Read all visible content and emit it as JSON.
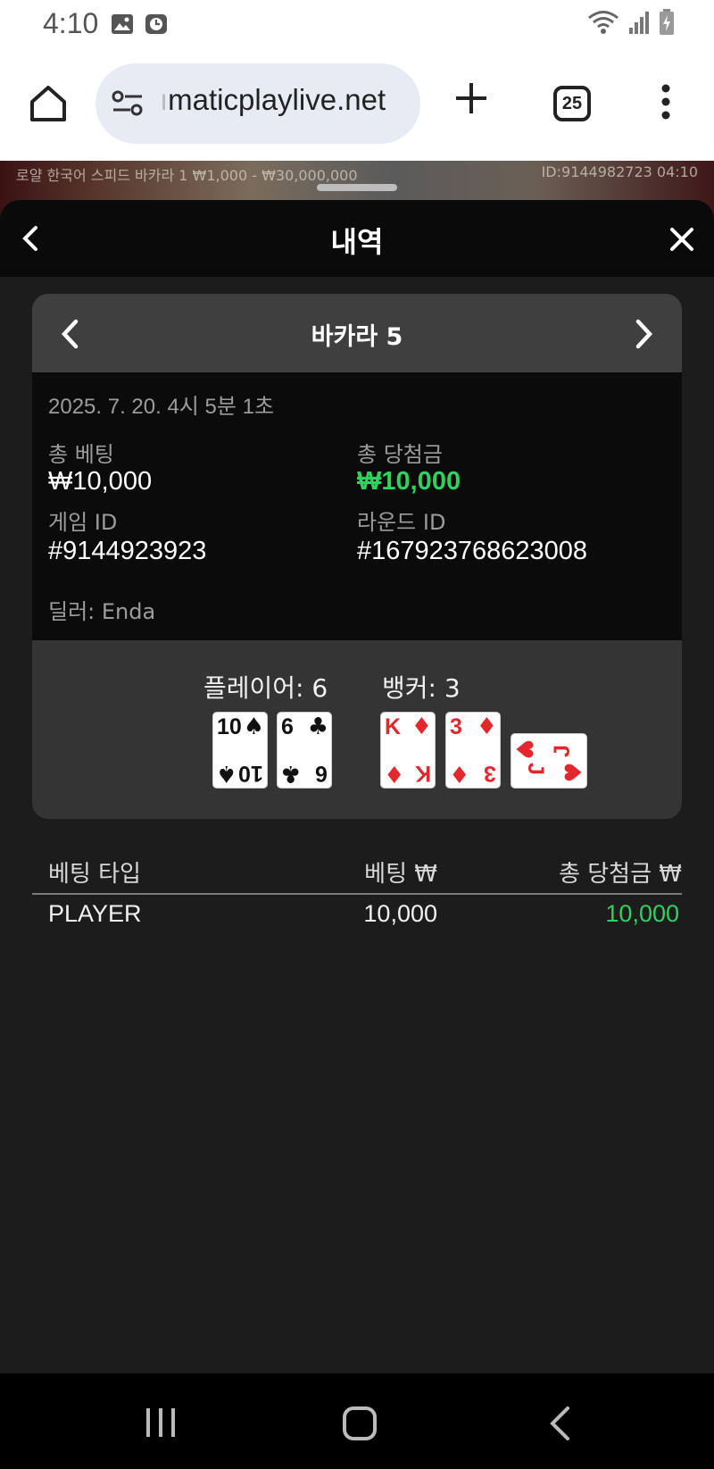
{
  "status": {
    "time": "4:10",
    "left_icons": [
      "image-icon",
      "clock-icon"
    ],
    "right_icons": [
      "wifi-icon",
      "signal-icon",
      "battery-icon"
    ]
  },
  "browser": {
    "url_faded": "ı",
    "url": "maticplaylive.net",
    "tab_count": "25"
  },
  "game_strip": {
    "info": "로얄 한국어 스피드 바카라 1  ₩1,000 - ₩30,000,000",
    "id_time": "ID:9144982723  04:10"
  },
  "sheet": {
    "title": "내역"
  },
  "card": {
    "title": "바카라 5",
    "date": "2025. 7. 20. 4시 5분 1초",
    "total_bet_label": "총 베팅",
    "total_bet_value": "₩10,000",
    "total_win_label": "총 당첨금",
    "total_win_value": "₩10,000",
    "game_id_label": "게임 ID",
    "game_id_value": "#9144923923",
    "round_id_label": "라운드 ID",
    "round_id_value": "#167923768623008",
    "dealer": "딜러: Enda"
  },
  "result": {
    "player_score": "플레이어: 6",
    "banker_score": "뱅커: 3",
    "player_cards": [
      {
        "rank": "10",
        "suit": "♠",
        "color": "black"
      },
      {
        "rank": "6",
        "suit": "♣",
        "color": "black"
      }
    ],
    "banker_cards": [
      {
        "rank": "K",
        "suit": "♦",
        "color": "red"
      },
      {
        "rank": "3",
        "suit": "♦",
        "color": "red"
      },
      {
        "rank": "J",
        "suit": "♥",
        "color": "red"
      }
    ]
  },
  "table": {
    "headers": {
      "type": "베팅 타입",
      "bet": "베팅 ₩",
      "win": "총 당첨금 ₩"
    },
    "rows": [
      {
        "type": "PLAYER",
        "bet": "10,000",
        "win": "10,000"
      }
    ]
  },
  "colors": {
    "win_green": "#2fd15f",
    "background": "#1c1c1c"
  }
}
